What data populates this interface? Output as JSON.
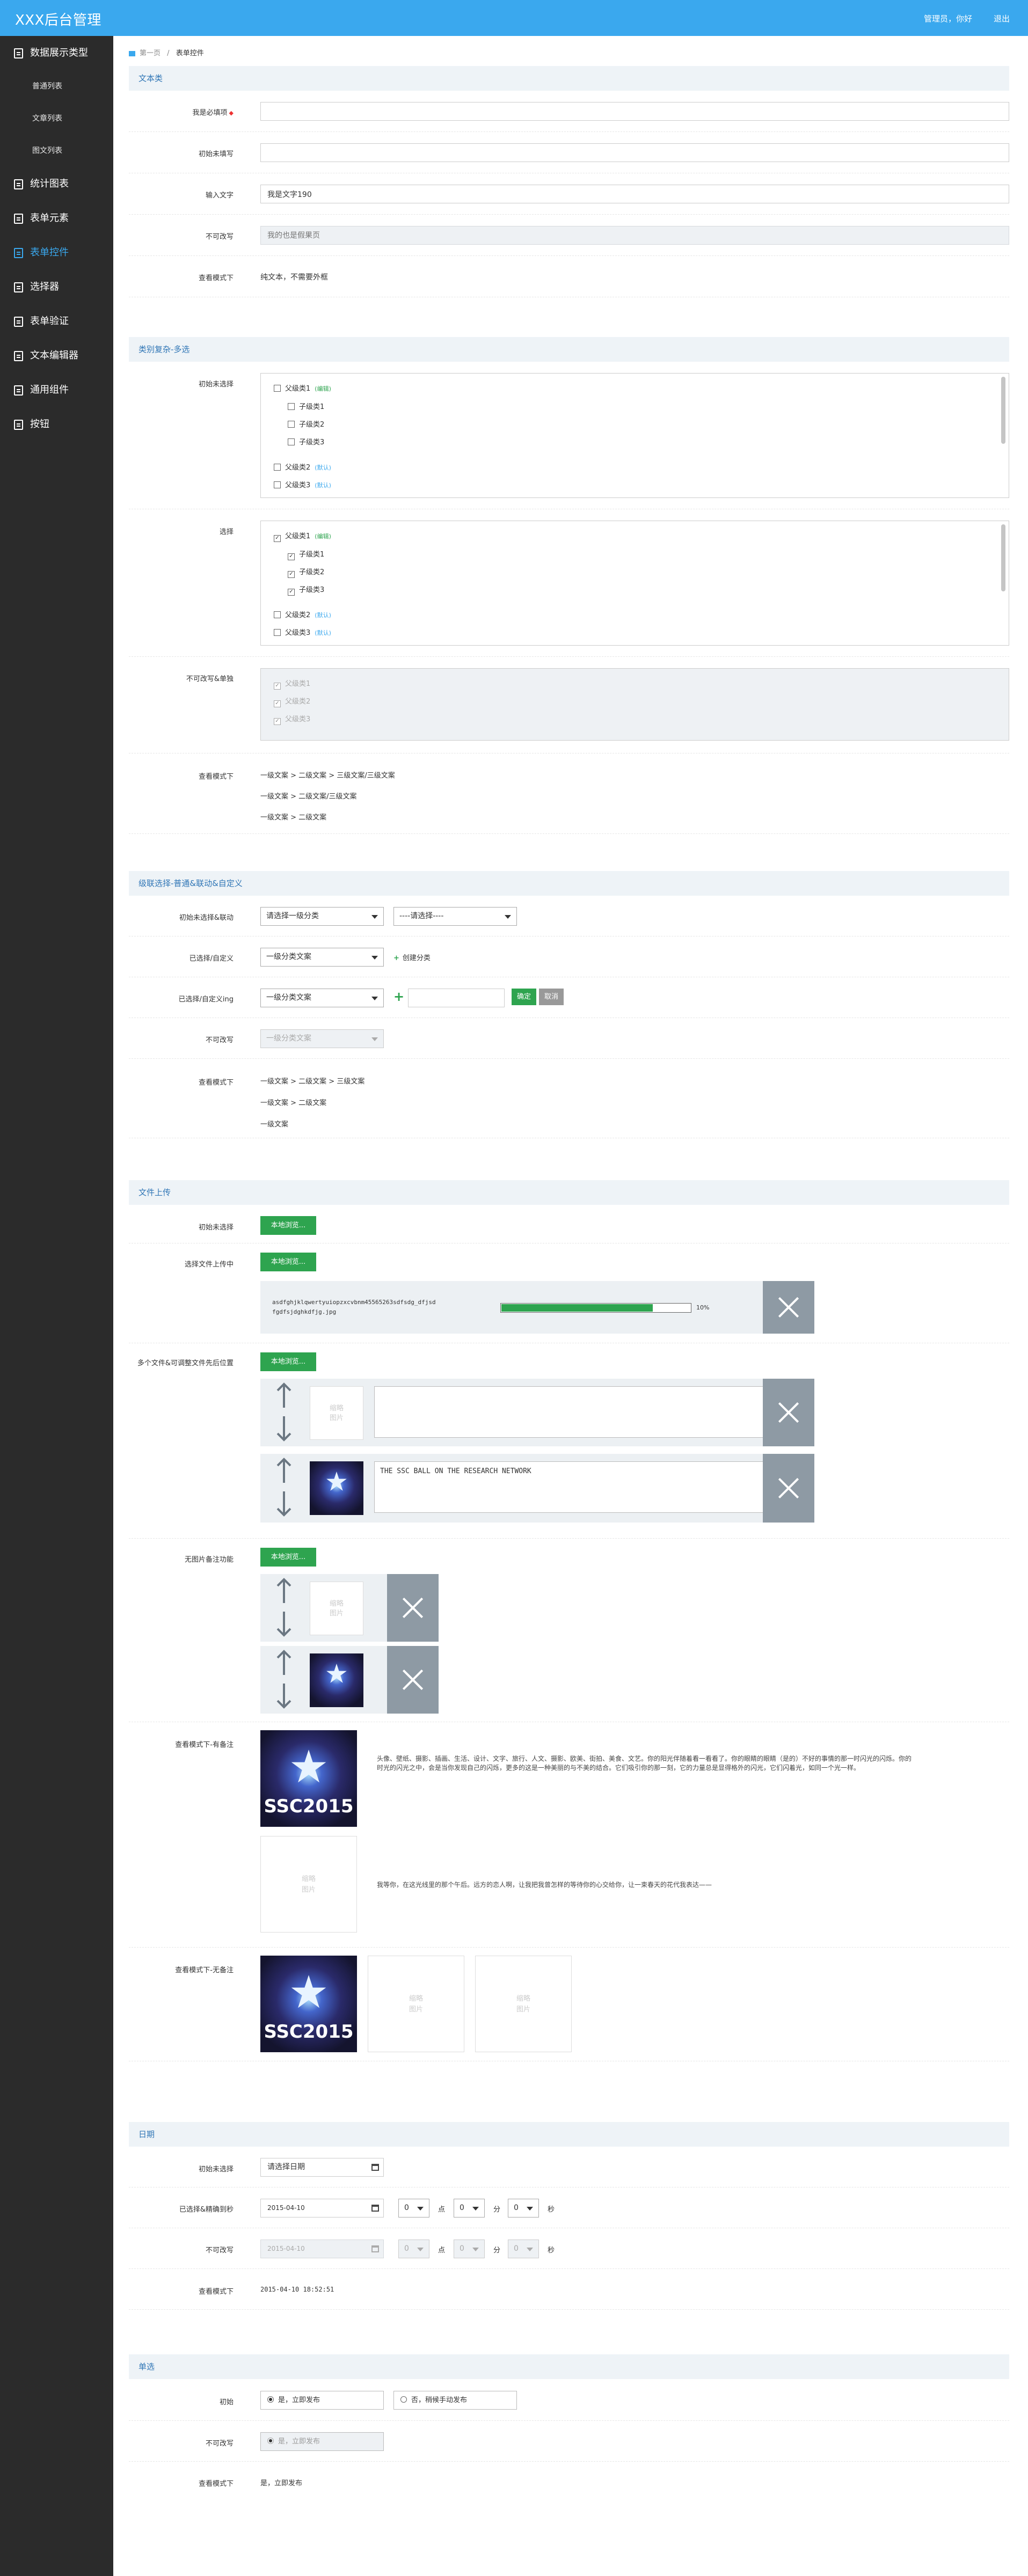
{
  "header": {
    "brand": "XXX后台管理",
    "user": "管理员，你好",
    "logout": "退出"
  },
  "sidebar": {
    "items": [
      {
        "label": "数据展示类型",
        "subs": [
          "普通列表",
          "文章列表",
          "图文列表"
        ]
      },
      {
        "label": "统计图表"
      },
      {
        "label": "表单元素"
      },
      {
        "label": "表单控件"
      },
      {
        "label": "选择器"
      },
      {
        "label": "表单验证"
      },
      {
        "label": "文本编辑器"
      },
      {
        "label": "通用组件"
      },
      {
        "label": "按钮"
      }
    ]
  },
  "breadcrumb": {
    "home": "第一页",
    "sep": "/",
    "current": "表单控件"
  },
  "text_section": {
    "title": "文本类",
    "rows": [
      {
        "label": "我是必填项",
        "value": ""
      },
      {
        "label": "初始未填写",
        "value": ""
      },
      {
        "label": "输入文字",
        "value": "我是文字190"
      },
      {
        "label": "不可改写",
        "placeholder": "我的也是假果页"
      },
      {
        "label": "查看模式下",
        "value": "纯文本，不需要外框"
      }
    ]
  },
  "tree_section": {
    "title": "类别复杂-多选",
    "initial_label": "初始未选择",
    "selected_label": "选择",
    "disabled_label": "不可改写&单独",
    "view_label": "查看模式下",
    "parent": "父级类1",
    "tag_edit": "(编辑)",
    "children": [
      "子级类1",
      "子级类2",
      "子级类3"
    ],
    "parent2": "父级类2",
    "parent3": "父级类3",
    "tag_none": "(默认)",
    "disabled_items": [
      "父级类1",
      "父级类2",
      "父级类3"
    ],
    "view_lines": [
      "一级文案 > 二级文案 > 三级文案/三级文案",
      "一级文案 > 二级文案/三级文案",
      "一级文案 > 二级文案"
    ]
  },
  "cascade_section": {
    "title": "级联选择-普通&联动&自定义",
    "row1_label": "初始未选择&联动",
    "row1_sel1": "请选择一级分类",
    "row1_sel2": "----请选择----",
    "row2_label": "已选择/自定义",
    "row2_sel": "一级分类文案",
    "row2_link": "创建分类",
    "row3_label": "已选择/自定义ing",
    "row3_sel": "一级分类文案",
    "row3_ok": "确定",
    "row3_cancel": "取消",
    "row4_label": "不可改写",
    "row4_sel": "一级分类文案",
    "row5_label": "查看模式下",
    "view_lines": [
      "一级文案 > 二级文案 > 三级文案",
      "一级文案 > 二级文案",
      "一级文案"
    ]
  },
  "upload_section": {
    "title": "文件上传",
    "browse": "本地浏览...",
    "row1_label": "初始未选择",
    "row2_label": "选择文件上传中",
    "file_name_1": "asdfghjklqwertyuiopzxcvbnm45565263sdfsdg_dfjsd",
    "file_name_2": "fgdfsjdghkdfjg.jpg",
    "progress": 0.8,
    "progress_text": "10%",
    "row3_label": "多个文件&可调整文件先后位置",
    "thumb_placeholder": "缩略\n图片",
    "caption_text": "THE SSC BALL ON THE RESEARCH NETWORK",
    "row4_label": "无图片备注功能",
    "row5_label": "查看模式下-有备注",
    "note1": "头像、壁纸、摄影、插画、生活、设计、文字、旅行、人文、摄影、欧美、街拍、美食、文艺。你的阳光伴随着看一看看了。你的眼睛的眼睛（是的）不好的事情的那一时闪光的闪烁。你的时光的闪光之中，会是当你发现自己的闪烁，更多的这是一种美丽的与不美的结合。它们吸引你的那一刻，它的力量总是显得格外的闪光，它们闪着光，如同一个光一样。",
    "note2": "我等你，在这光线里的那个午后。远方的恋人啊，让我把我曾怎样的等待你的心交给你，让一束春天的花代我表达——",
    "pic_caption": "SSC2015",
    "row6_label": "查看模式下-无备注"
  },
  "date_section": {
    "title": "日期",
    "row1_label": "初始未选择",
    "row1_value": "请选择日期",
    "row2_label": "已选择&精确到秒",
    "row2_value": "2015-04-10",
    "h": "0",
    "m": "0",
    "s": "0",
    "hour_unit": "点",
    "min_unit": "分",
    "sec_unit": "秒",
    "row3_label": "不可改写",
    "row3_value": "2015-04-10",
    "row4_label": "查看模式下",
    "row4_value": "2015-04-10 18:52:51"
  },
  "radio_section": {
    "title": "单选",
    "row1_label": "初始",
    "opt1": "是，立即发布",
    "opt2": "否，稍候手动发布",
    "row2_label": "不可改写",
    "row2_value": "是，立即发布",
    "row3_label": "查看模式下",
    "row3_value": "是，立即发布"
  }
}
